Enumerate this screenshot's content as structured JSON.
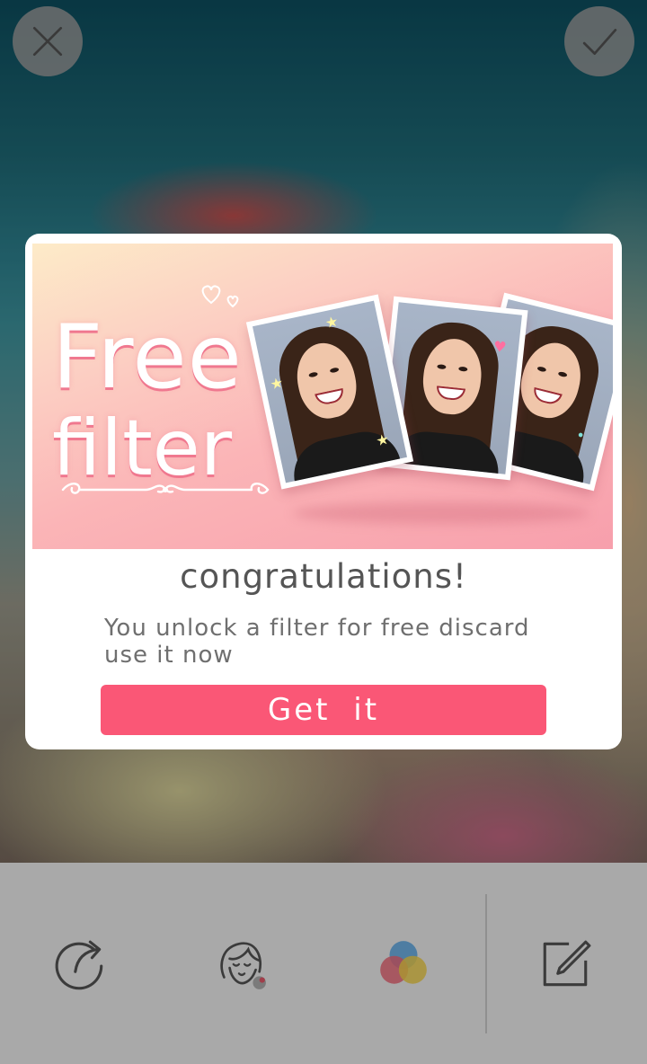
{
  "top_bar": {
    "close_icon": "close-icon",
    "confirm_icon": "checkmark-icon"
  },
  "modal": {
    "banner": {
      "title_line1": "Free",
      "title_line2": "filter",
      "colors": {
        "gradient_top": "#fdebc8",
        "gradient_bottom": "#f79fac",
        "title_shadow": "#f0788f"
      }
    },
    "title": "congratulations!",
    "body": "You unlock a filter for free discard use it now",
    "button_label": "Get  it",
    "button_color": "#fa5776"
  },
  "toolbar": {
    "items": [
      {
        "icon": "share-icon"
      },
      {
        "icon": "face-beauty-icon"
      },
      {
        "icon": "color-filter-icon"
      },
      {
        "icon": "edit-icon"
      }
    ]
  }
}
